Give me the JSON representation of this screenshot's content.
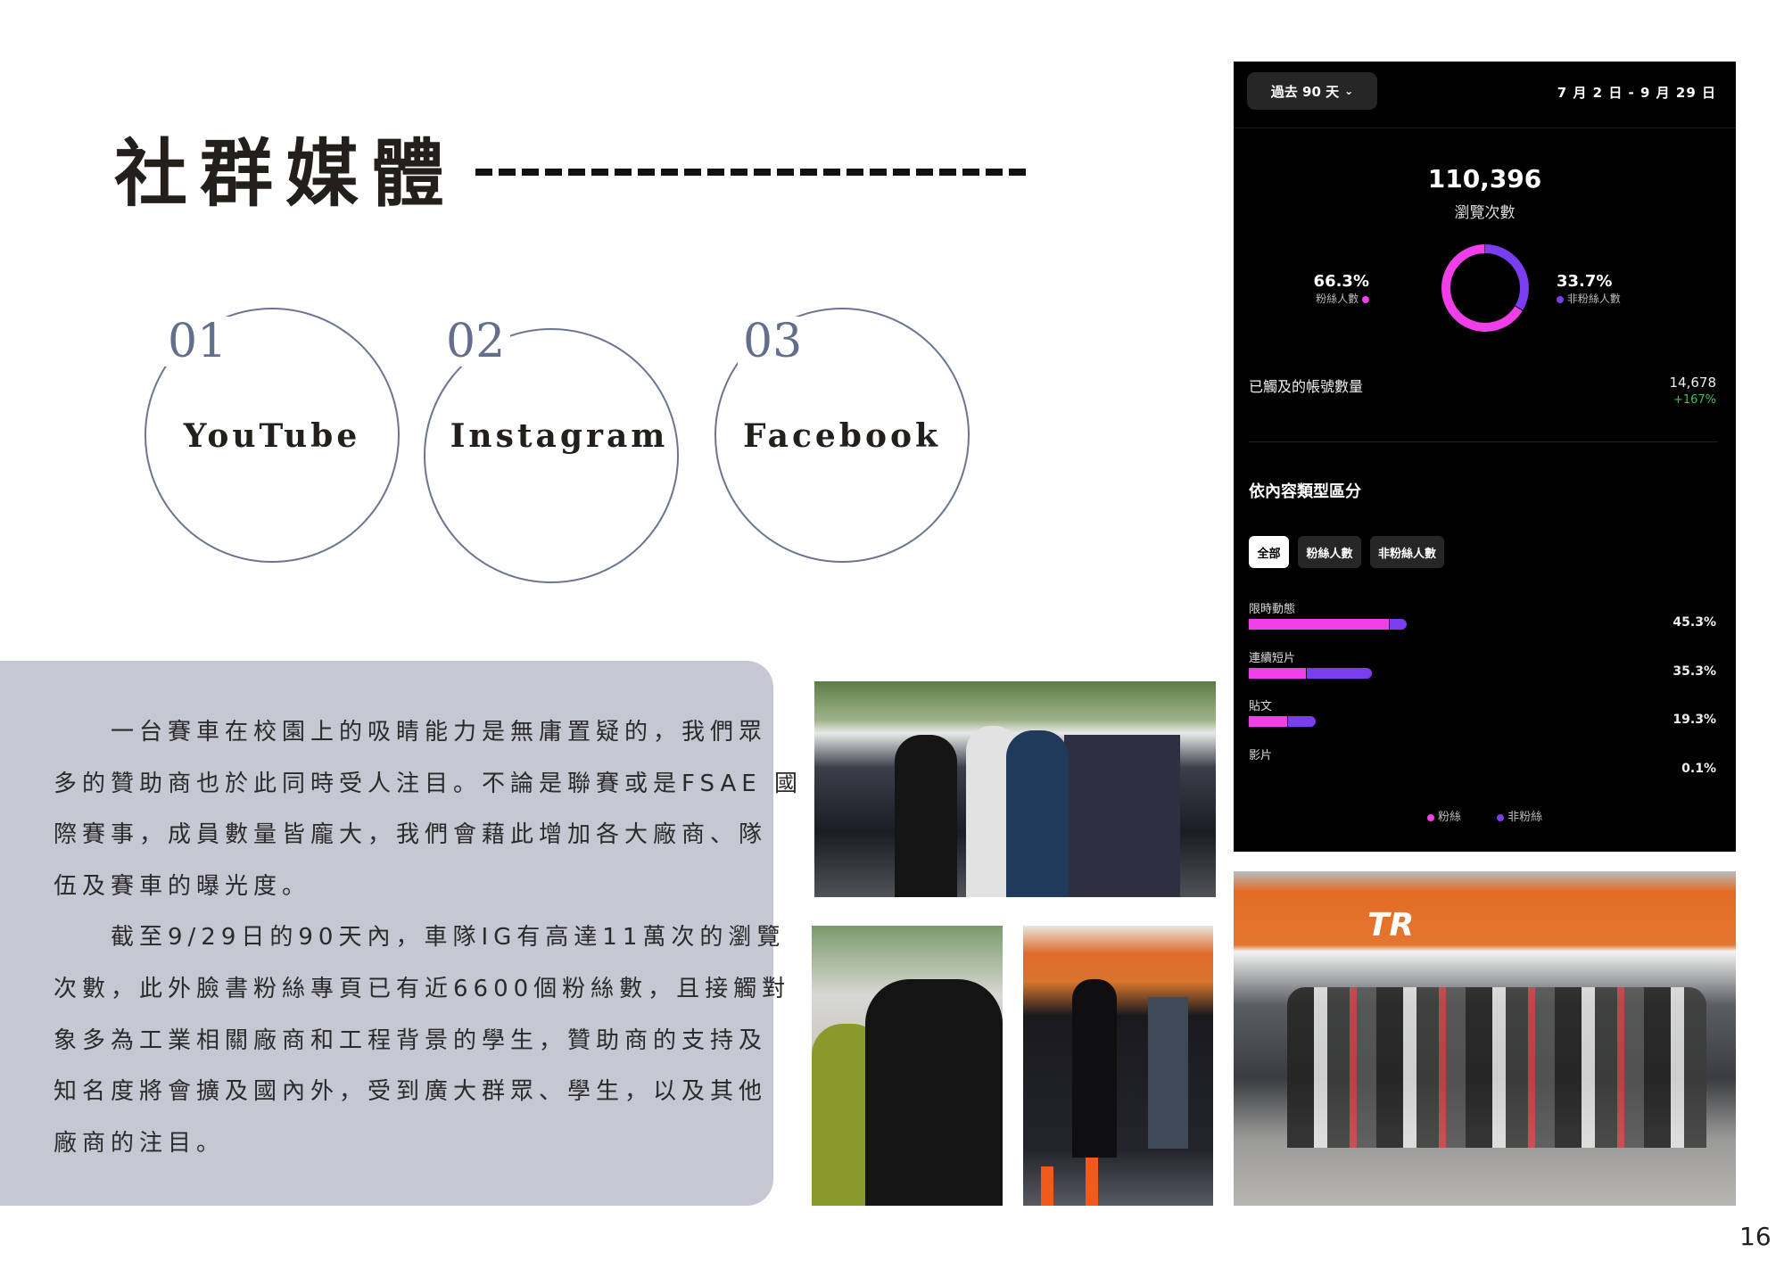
{
  "page": {
    "title": "社群媒體",
    "page_number": "16"
  },
  "platforms": [
    {
      "number": "01",
      "name": "YouTube"
    },
    {
      "number": "02",
      "name": "Instagram"
    },
    {
      "number": "03",
      "name": "Facebook"
    }
  ],
  "description": {
    "lines": [
      "　　一台賽車在校園上的吸睛能力是無庸置疑的，我們眾",
      "多的贊助商也於此同時受人注目。不論是聯賽或是FSAE 國",
      "際賽事，成員數量皆龐大，我們會藉此增加各大廠商、隊",
      "伍及賽車的曝光度。",
      "　　截至9/29日的90天內，車隊IG有高達11萬次的瀏覽",
      "次數，此外臉書粉絲專頁已有近6600個粉絲數，且接觸對",
      "象多為工業相關廠商和工程背景的學生，贊助商的支持及",
      "知名度將會擴及國內外，受到廣大群眾、學生，以及其他",
      "廠商的注目。"
    ]
  },
  "insights": {
    "period_dropdown": "過去 90 天",
    "date_range": "7 月 2 日 - 9 月 29 日",
    "views_total": "110,396",
    "views_label": "瀏覽次數",
    "followers_pct": "66.3%",
    "followers_label": "粉絲人數",
    "nonfollowers_pct": "33.7%",
    "nonfollowers_label": "非粉絲人數",
    "accounts_reached_label": "已觸及的帳號數量",
    "accounts_reached_value": "14,678",
    "accounts_reached_change": "+167%",
    "breakdown_title": "依內容類型區分",
    "filters": [
      {
        "label": "全部",
        "active": true
      },
      {
        "label": "粉絲人數",
        "active": false
      },
      {
        "label": "非粉絲人數",
        "active": false
      }
    ],
    "legend": {
      "fans": "粉絲",
      "nonfans": "非粉絲"
    },
    "colors": {
      "fans": "#f03fe8",
      "nonfans": "#7a3df0",
      "positive": "#3fbf5a"
    }
  },
  "chart_data": [
    {
      "type": "pie",
      "title": "瀏覽次數",
      "slices": [
        {
          "name": "粉絲人數",
          "value": 66.3
        },
        {
          "name": "非粉絲人數",
          "value": 33.7
        }
      ]
    },
    {
      "type": "bar",
      "title": "依內容類型區分",
      "categories": [
        "限時動態",
        "連續短片",
        "貼文",
        "影片"
      ],
      "totals_label": [
        "45.3%",
        "35.3%",
        "19.3%",
        "0.1%"
      ],
      "series": [
        {
          "name": "粉絲",
          "values": [
            40.2,
            16.5,
            11.0,
            0.1
          ]
        },
        {
          "name": "非粉絲",
          "values": [
            5.1,
            18.8,
            8.3,
            0.0
          ]
        }
      ]
    }
  ]
}
